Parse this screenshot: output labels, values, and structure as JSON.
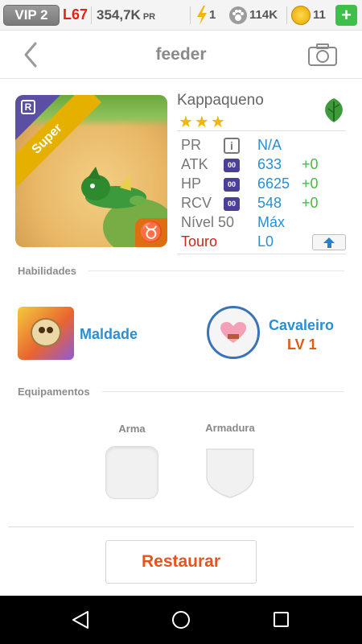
{
  "status_bar": {
    "vip": "VIP 2",
    "level": "L67",
    "power": "354,7K",
    "power_unit": "PR",
    "energy": "1",
    "food": "114K",
    "coins": "11",
    "add_label": "+"
  },
  "header": {
    "title": "feeder"
  },
  "monster": {
    "name": "Kappaqueno",
    "stars": "★★★",
    "badge": "Super",
    "rarity": "R",
    "zodiac_symbol": "♉",
    "element_icon": "leaf-icon",
    "stats": [
      {
        "label": "PR",
        "icon": "i",
        "value": "N/A",
        "bonus": ""
      },
      {
        "label": "ATK",
        "icon": "00",
        "value": "633",
        "bonus": "+0"
      },
      {
        "label": "HP",
        "icon": "00",
        "value": "6625",
        "bonus": "+0"
      },
      {
        "label": "RCV",
        "icon": "00",
        "value": "548",
        "bonus": "+0"
      },
      {
        "label": "Nível 50",
        "icon": "",
        "value": "Máx",
        "bonus": ""
      },
      {
        "label": "Touro",
        "icon": "",
        "value": "L0",
        "bonus": ""
      }
    ]
  },
  "abilities": {
    "title": "Habilidades",
    "skill_name": "Maldade",
    "leader_name": "Cavaleiro",
    "leader_level": "LV 1"
  },
  "equipment": {
    "title": "Equipamentos",
    "weapon_label": "Arma",
    "armor_label": "Armadura"
  },
  "actions": {
    "restore_label": "Restaurar"
  },
  "colors": {
    "accent_blue": "#2a8fd3",
    "bonus_green": "#3fbf3f",
    "restore_orange": "#e8521d",
    "level_red": "#e2231a"
  }
}
